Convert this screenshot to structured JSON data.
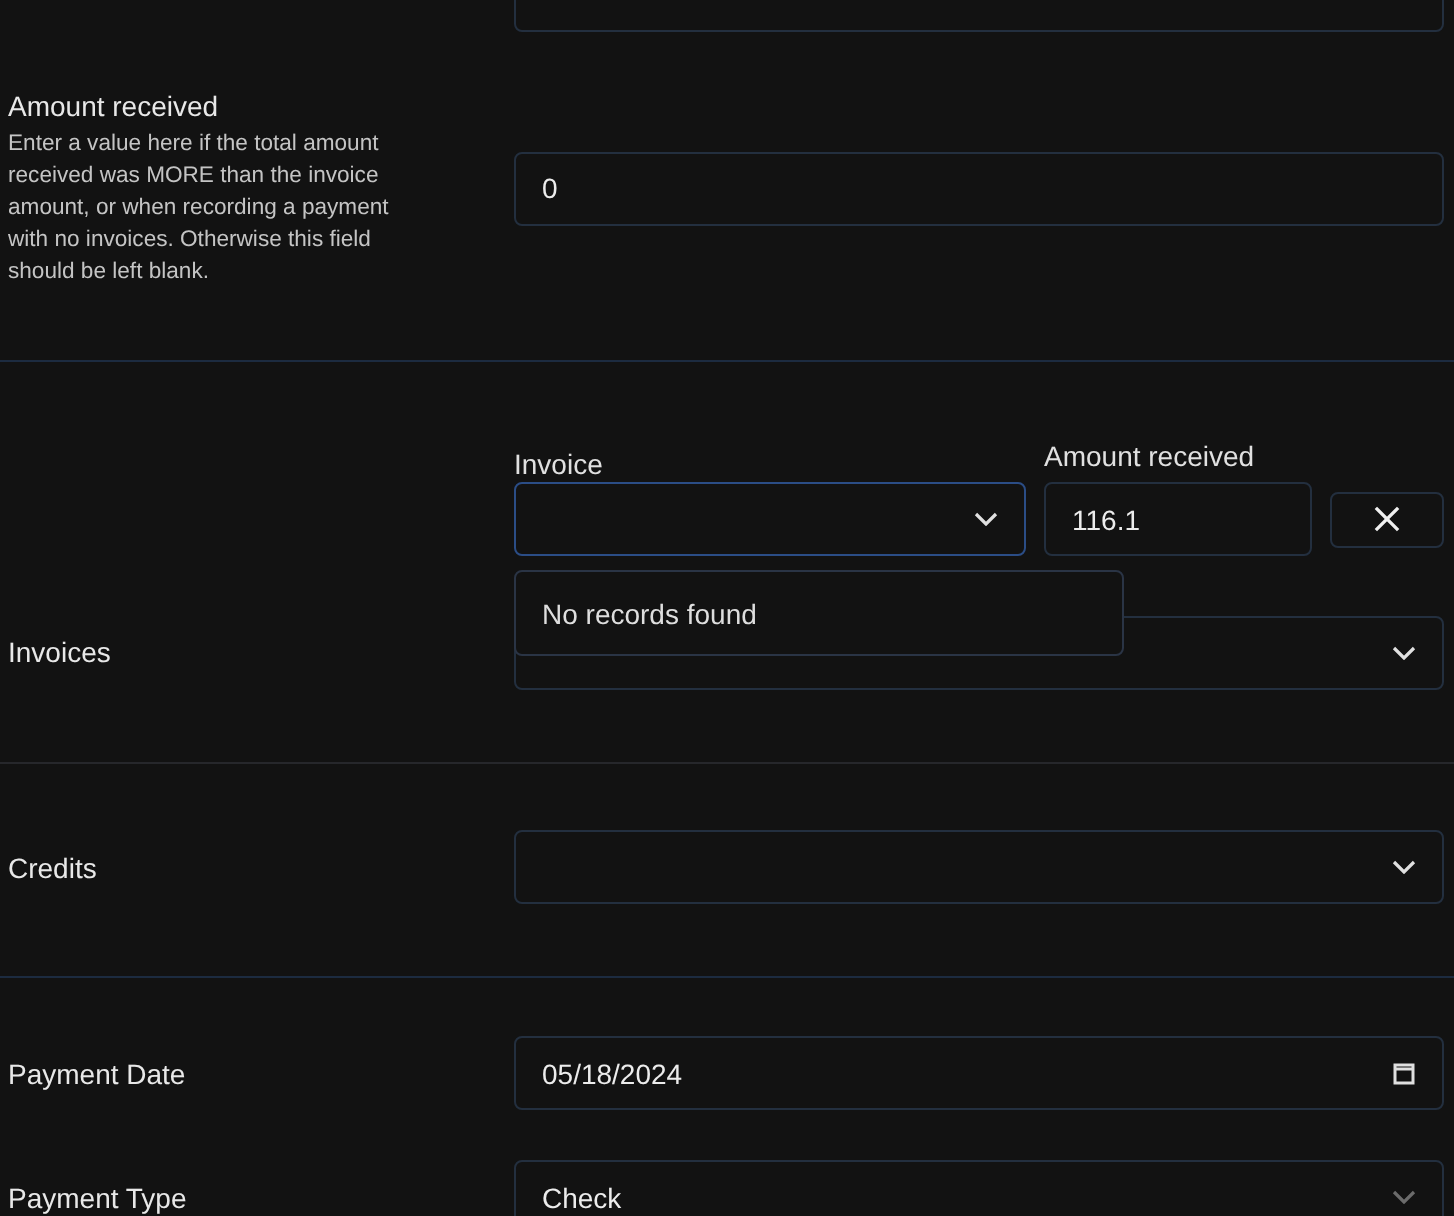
{
  "amount_received": {
    "label": "Amount received",
    "help": "Enter a value here if the total amount received was MORE than the invoice amount, or when recording a payment with no invoices. Otherwise this field should be left blank.",
    "value": "0"
  },
  "invoices": {
    "label": "Invoices",
    "invoice_heading": "Invoice",
    "amount_heading": "Amount received",
    "lines": [
      {
        "amount": "116.1",
        "dropdown_open": true,
        "dropdown_message": "No records found"
      }
    ]
  },
  "credits": {
    "label": "Credits"
  },
  "payment_date": {
    "label": "Payment Date",
    "value": "05/18/2024"
  },
  "payment_type": {
    "label": "Payment Type",
    "value": "Check",
    "disabled": true
  }
}
